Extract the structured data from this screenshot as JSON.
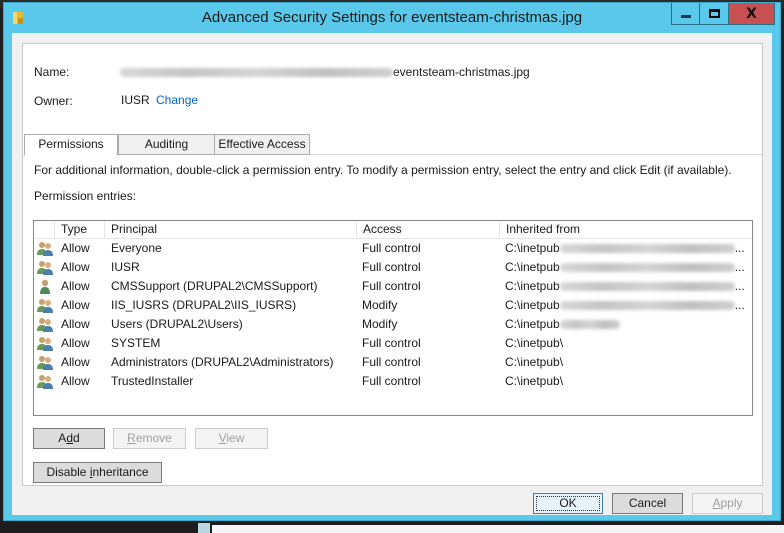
{
  "window": {
    "title": "Advanced Security Settings for eventsteam-christmas.jpg",
    "icon": "folder-lock-icon",
    "caption_buttons": [
      "minimize",
      "maximize",
      "close"
    ],
    "close_color": "#c75050",
    "frame_color": "#5ac8ea"
  },
  "info": {
    "name_label": "Name:",
    "name_value_visible": "eventsteam-christmas.jpg",
    "name_prefix_blurred": true,
    "owner_label": "Owner:",
    "owner_value": "IUSR",
    "change_link": "Change"
  },
  "tabs": [
    {
      "label": "Permissions",
      "active": true
    },
    {
      "label": "Auditing",
      "active": false
    },
    {
      "label": "Effective Access",
      "active": false
    }
  ],
  "instructions": "For additional information, double-click a permission entry. To modify a permission entry, select the entry and click Edit (if available).",
  "entries_label": "Permission entries:",
  "table": {
    "columns": [
      "Type",
      "Principal",
      "Access",
      "Inherited from"
    ],
    "rows": [
      {
        "icon": "group-icon",
        "type": "Allow",
        "principal": "Everyone",
        "access": "Full control",
        "inherited": "C:\\inetpub",
        "inherited_blurred": true,
        "ellipsis": "..."
      },
      {
        "icon": "group-icon",
        "type": "Allow",
        "principal": "IUSR",
        "access": "Full control",
        "inherited": "C:\\inetpub",
        "inherited_blurred": true,
        "ellipsis": "..."
      },
      {
        "icon": "user-icon",
        "type": "Allow",
        "principal": "CMSSupport (DRUPAL2\\CMSSupport)",
        "access": "Full control",
        "inherited": "C:\\inetpub",
        "inherited_blurred": true,
        "ellipsis": "..."
      },
      {
        "icon": "group-icon",
        "type": "Allow",
        "principal": "IIS_IUSRS (DRUPAL2\\IIS_IUSRS)",
        "access": "Modify",
        "inherited": "C:\\inetpub",
        "inherited_blurred": true,
        "ellipsis": "..."
      },
      {
        "icon": "group-icon",
        "type": "Allow",
        "principal": "Users (DRUPAL2\\Users)",
        "access": "Modify",
        "inherited": "C:\\inetpub",
        "inherited_blurred": true,
        "ellipsis": ""
      },
      {
        "icon": "group-icon",
        "type": "Allow",
        "principal": "SYSTEM",
        "access": "Full control",
        "inherited": "C:\\inetpub\\",
        "inherited_blurred": false,
        "ellipsis": ""
      },
      {
        "icon": "group-icon",
        "type": "Allow",
        "principal": "Administrators (DRUPAL2\\Administrators)",
        "access": "Full control",
        "inherited": "C:\\inetpub\\",
        "inherited_blurred": false,
        "ellipsis": ""
      },
      {
        "icon": "group-icon",
        "type": "Allow",
        "principal": "TrustedInstaller",
        "access": "Full control",
        "inherited": "C:\\inetpub\\",
        "inherited_blurred": false,
        "ellipsis": ""
      }
    ]
  },
  "buttons": {
    "add": {
      "pre": "A",
      "mn": "d",
      "post": "d",
      "enabled": true
    },
    "remove": {
      "pre": "",
      "mn": "R",
      "post": "emove",
      "enabled": false
    },
    "view": {
      "pre": "",
      "mn": "V",
      "post": "iew",
      "enabled": false
    },
    "disable_inheritance": {
      "pre": "Disable ",
      "mn": "i",
      "post": "nheritance",
      "enabled": true
    },
    "ok": {
      "label": "OK",
      "enabled": true
    },
    "cancel": {
      "label": "Cancel",
      "enabled": true
    },
    "apply": {
      "pre": "",
      "mn": "A",
      "post": "pply",
      "enabled": false
    }
  }
}
